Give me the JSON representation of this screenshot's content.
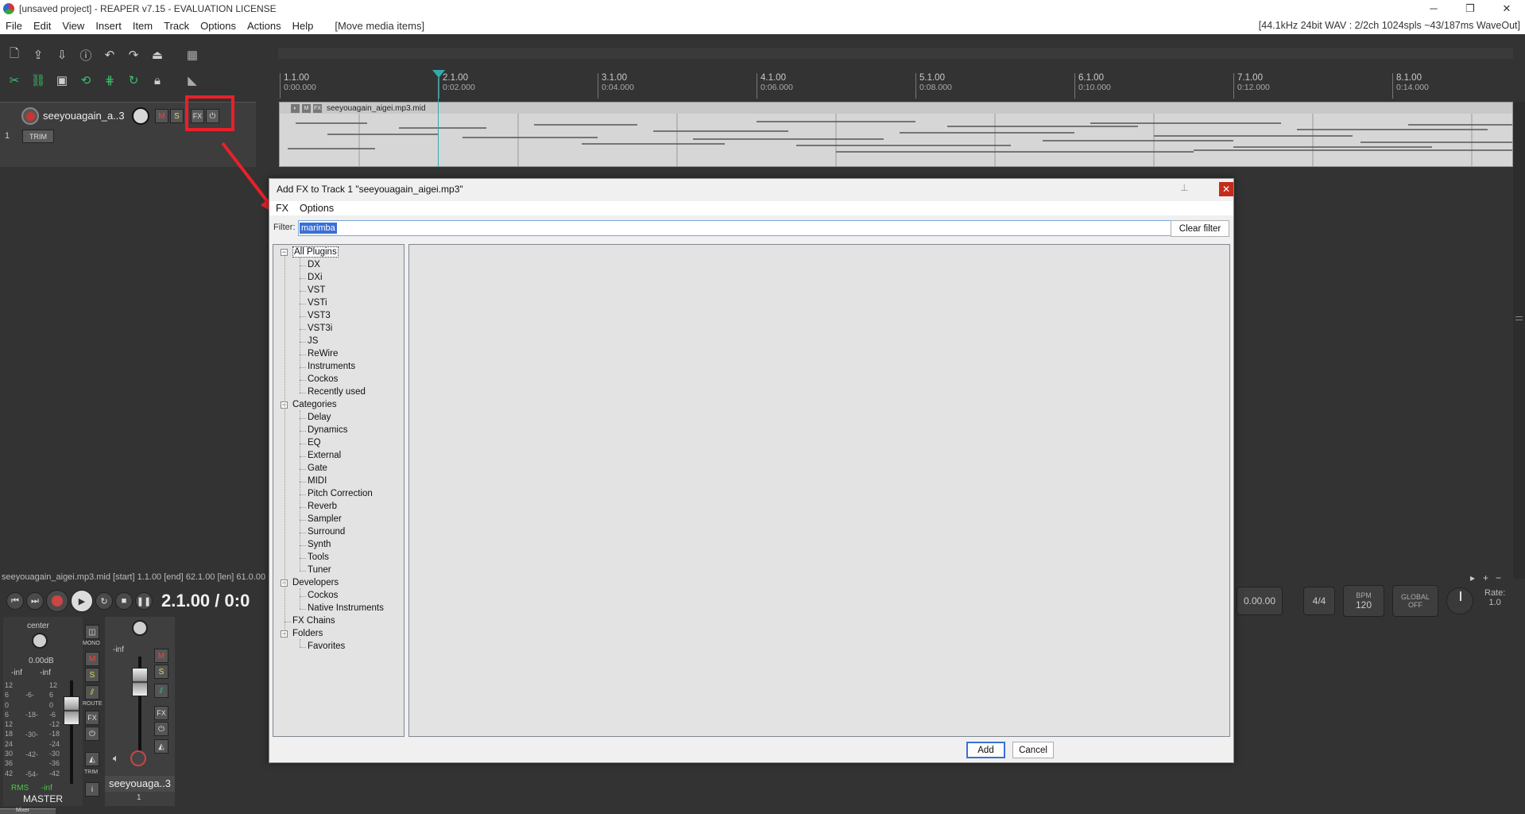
{
  "window": {
    "title": "[unsaved project] - REAPER v7.15 - EVALUATION LICENSE",
    "minimize": "─",
    "restore": "❐",
    "close": "✕"
  },
  "menu": {
    "items": [
      "File",
      "Edit",
      "View",
      "Insert",
      "Item",
      "Track",
      "Options",
      "Actions",
      "Help"
    ],
    "last_action": "[Move media items]",
    "audio_status": "[44.1kHz 24bit WAV : 2/2ch 1024spls ~43/187ms WaveOut]"
  },
  "track": {
    "number": "1",
    "name": "seeyouagain_a..3",
    "mute": "M",
    "solo": "S",
    "fx": "FX",
    "fx_bypass": "⏻",
    "trim": "TRIM"
  },
  "ruler": [
    {
      "measure": "1.1.00",
      "time": "0:00.000"
    },
    {
      "measure": "2.1.00",
      "time": "0:02.000"
    },
    {
      "measure": "3.1.00",
      "time": "0:04.000"
    },
    {
      "measure": "4.1.00",
      "time": "0:06.000"
    },
    {
      "measure": "5.1.00",
      "time": "0:08.000"
    },
    {
      "measure": "6.1.00",
      "time": "0:10.000"
    },
    {
      "measure": "7.1.00",
      "time": "0:12.000"
    },
    {
      "measure": "8.1.00",
      "time": "0:14.000"
    }
  ],
  "media_item": {
    "name": "seeyouagain_aigei.mp3.mid",
    "btn_m": "M",
    "btn_fx": "FX"
  },
  "item_status": "seeyouagain_aigei.mp3.mid [start] 1.1.00 [end] 62.1.00 [len] 61.0.00",
  "transport": {
    "position": "2.1.00 / 0:0",
    "time_value": "0.00.00",
    "time_sig": "4/4",
    "bpm_label": "BPM",
    "bpm": "120",
    "global_label": "GLOBAL",
    "global_value": "OFF",
    "rate_label": "Rate:",
    "rate_value": "1.0"
  },
  "mixer": {
    "master": {
      "pan": "center",
      "volume": "0.00dB",
      "peak_l": "-inf",
      "peak_r": "-inf",
      "scale_left": [
        "12",
        "6",
        "0",
        "6",
        "12",
        "18",
        "24",
        "30",
        "36",
        "42"
      ],
      "scale_mid": [
        "-6-",
        "-18-",
        "-30-",
        "-42-",
        "-54-"
      ],
      "scale_right": [
        "12",
        "6",
        "0",
        "-6",
        "-12",
        "-18",
        "-24",
        "-30",
        "-36",
        "-42"
      ],
      "rms": "RMS",
      "rms_value": "-inf",
      "name": "MASTER",
      "mono": "MONO",
      "route": "ROUTE",
      "fx": "FX",
      "trim": "TRIM",
      "mute": "M",
      "solo": "S"
    },
    "track": {
      "peak": "-inf",
      "mute": "M",
      "solo": "S",
      "fx": "FX",
      "name": "seeyouaga..3",
      "number": "1"
    },
    "tab": "Mixer"
  },
  "dialog": {
    "title": "Add FX to Track 1 \"seeyouagain_aigei.mp3\"",
    "close": "✕",
    "pin": "⊥",
    "menu": [
      "FX",
      "Options"
    ],
    "filter_label": "Filter:",
    "filter_value": "marimba",
    "clear_filter": "Clear filter",
    "add": "Add",
    "cancel": "Cancel",
    "tree": [
      {
        "label": "All Plugins",
        "level": 0,
        "expander": "−",
        "selected": true
      },
      {
        "label": "DX",
        "level": 1
      },
      {
        "label": "DXi",
        "level": 1
      },
      {
        "label": "VST",
        "level": 1
      },
      {
        "label": "VSTi",
        "level": 1
      },
      {
        "label": "VST3",
        "level": 1
      },
      {
        "label": "VST3i",
        "level": 1
      },
      {
        "label": "JS",
        "level": 1
      },
      {
        "label": "ReWire",
        "level": 1
      },
      {
        "label": "Instruments",
        "level": 1
      },
      {
        "label": "Cockos",
        "level": 1
      },
      {
        "label": "Recently used",
        "level": 1
      },
      {
        "label": "Categories",
        "level": 0,
        "expander": "−"
      },
      {
        "label": "Delay",
        "level": 1
      },
      {
        "label": "Dynamics",
        "level": 1
      },
      {
        "label": "EQ",
        "level": 1
      },
      {
        "label": "External",
        "level": 1
      },
      {
        "label": "Gate",
        "level": 1
      },
      {
        "label": "MIDI",
        "level": 1
      },
      {
        "label": "Pitch Correction",
        "level": 1
      },
      {
        "label": "Reverb",
        "level": 1
      },
      {
        "label": "Sampler",
        "level": 1
      },
      {
        "label": "Surround",
        "level": 1
      },
      {
        "label": "Synth",
        "level": 1
      },
      {
        "label": "Tools",
        "level": 1
      },
      {
        "label": "Tuner",
        "level": 1
      },
      {
        "label": "Developers",
        "level": 0,
        "expander": "−"
      },
      {
        "label": "Cockos",
        "level": 1
      },
      {
        "label": "Native Instruments",
        "level": 1
      },
      {
        "label": "FX Chains",
        "level": 0
      },
      {
        "label": "Folders",
        "level": 0,
        "expander": "−"
      },
      {
        "label": "Favorites",
        "level": 1
      }
    ]
  }
}
